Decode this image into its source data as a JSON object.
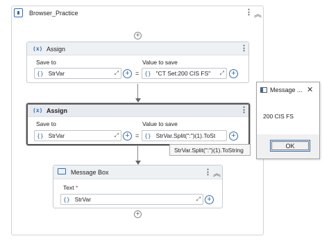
{
  "sequence": {
    "title": "Browser_Practice"
  },
  "assign1": {
    "title": "Assign",
    "icon": "(x)",
    "save_to_label": "Save to",
    "value_label": "Value to save",
    "save_to_value": "StrVar",
    "value_text": "\"CT Set:200 CIS FS\"",
    "brace": "{}",
    "eq": "="
  },
  "assign2": {
    "title": "Assign",
    "icon": "(x)",
    "save_to_label": "Save to",
    "value_label": "Value to save",
    "save_to_value": "StrVar",
    "value_text": "StrVar.Split(\":\")(1).ToSt",
    "brace": "{}",
    "eq": "=",
    "tooltip": "StrVar.Split(\":\")(1).ToString"
  },
  "message_box": {
    "title": "Message Box",
    "text_label": "Text",
    "required_mark": "*",
    "text_value": "StrVar",
    "brace": "{}"
  },
  "dialog": {
    "title": "Message ...",
    "body": "200 CIS FS",
    "ok_label": "OK",
    "close_glyph": "✕"
  },
  "icons": {
    "kebab": "⋮",
    "collapse": "⌃⌃",
    "plus": "+",
    "expand": "⤢"
  }
}
